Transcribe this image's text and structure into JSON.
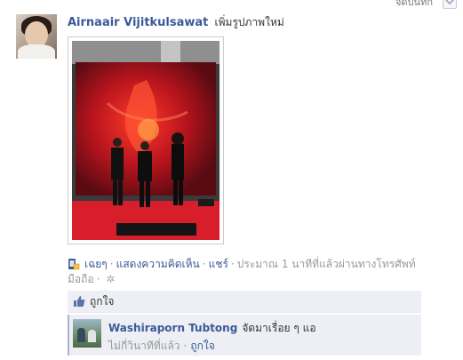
{
  "top": {
    "cut_label": "จัดบันทึก"
  },
  "post": {
    "author": "Airnaair Vijitkulsawat",
    "action": "เพิ่มรูปภาพใหม่",
    "actions": {
      "like": "เฉยๆ",
      "comment": "แสดงความคิดเห็น",
      "share": "แชร์",
      "time_line1": "ประมาณ 1 นาทีที่แล้วผ่านทางโทรศัพท์",
      "time_line2": "มือถือ"
    },
    "likes_text": "ถูกใจ"
  },
  "comment": {
    "author": "Washiraporn Tubtong",
    "text": "จัดมาเรื่อย ๆ แอ",
    "time": "ไม่กี่วินาทีที่แล้ว",
    "like": "ถูกใจ"
  },
  "colors": {
    "link": "#3b5998",
    "ufi_bg": "#edeff4",
    "muted": "#999999"
  }
}
